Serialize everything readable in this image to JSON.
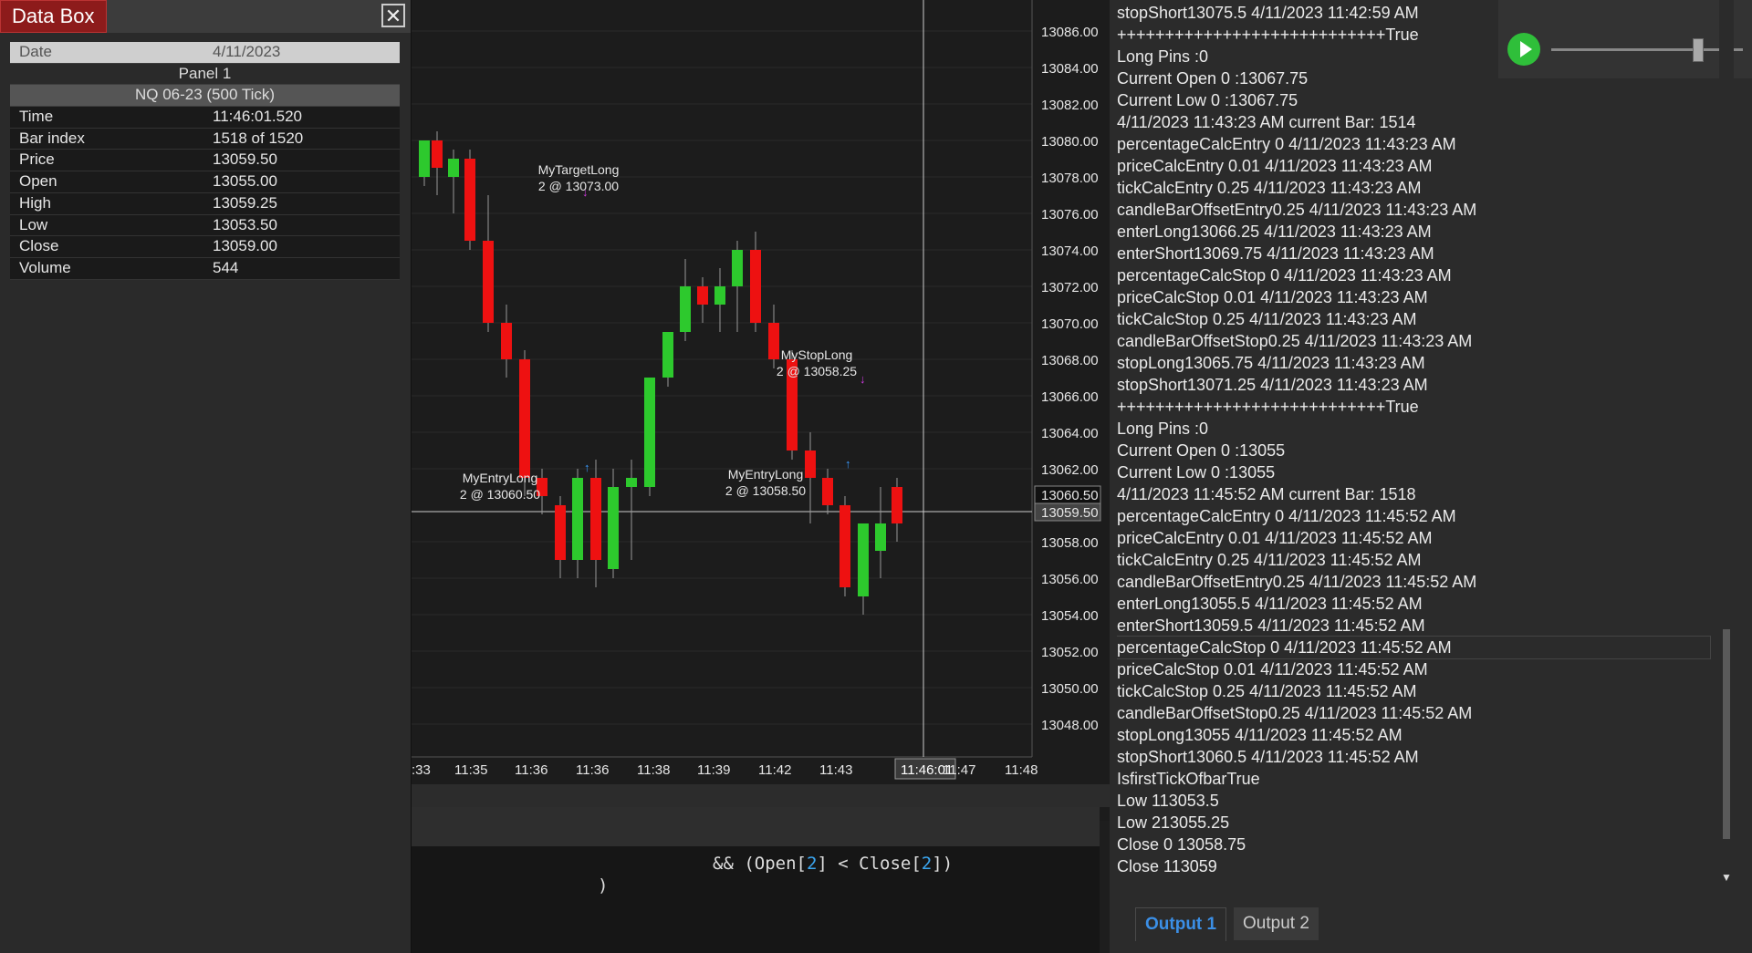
{
  "data_box": {
    "title": "Data Box",
    "close_glyph": "✕",
    "date_label": "Date",
    "date_value": "4/11/2023",
    "panel_label": "Panel 1",
    "instrument": "NQ 06-23 (500 Tick)",
    "rows": [
      {
        "k": "Time",
        "v": "11:46:01.520"
      },
      {
        "k": "Bar index",
        "v": "1518 of 1520"
      },
      {
        "k": "Price",
        "v": "13059.50"
      },
      {
        "k": "Open",
        "v": "13055.00"
      },
      {
        "k": "High",
        "v": "13059.25"
      },
      {
        "k": "Low",
        "v": "13053.50"
      },
      {
        "k": "Close",
        "v": "13059.00"
      },
      {
        "k": "Volume",
        "v": "544"
      }
    ]
  },
  "chart": {
    "price_ticks": [
      "13086.00",
      "13084.00",
      "13082.00",
      "13080.00",
      "13078.00",
      "13076.00",
      "13074.00",
      "13072.00",
      "13070.00",
      "13068.00",
      "13066.00",
      "13064.00",
      "13062.00",
      "13060.50",
      "13059.50",
      "13058.00",
      "13056.00",
      "13054.00",
      "13052.00",
      "13050.00",
      "13048.00"
    ],
    "time_ticks": [
      ":33",
      "11:35",
      "11:36",
      "11:36",
      "11:38",
      "11:39",
      "11:42",
      "11:43",
      "11:46:01",
      "11:47",
      "11:48"
    ],
    "cursor_time": "11:46:01",
    "price_highlight_upper": "13060.50",
    "price_highlight_lower": "13059.50",
    "labels": [
      {
        "name": "MyTargetLong",
        "qty": "2 @ 13073.00"
      },
      {
        "name": "MyStopLong",
        "qty": "2 @ 13058.25"
      },
      {
        "name": "MyEntryLong",
        "qty": "2 @ 13060.50"
      },
      {
        "name": "MyEntryLong",
        "qty": "2 @ 13058.50"
      }
    ],
    "colors": {
      "up": "#2dc92d",
      "down": "#ee1111",
      "bg": "#1c1c1c"
    }
  },
  "code": {
    "line1_prefix": "&& (Open[",
    "line1_n1": "2",
    "line1_mid": "] < Close[",
    "line1_n2": "2",
    "line1_suffix": "])",
    "line2": ")"
  },
  "output": {
    "lines": [
      "stopShort13075.5 4/11/2023 11:42:59 AM",
      "++++++++++++++++++++++++++++True",
      "Long Pins :0",
      "Current Open 0 :13067.75",
      "Current Low 0 :13067.75",
      "4/11/2023 11:43:23 AM current Bar: 1514",
      "percentageCalcEntry 0 4/11/2023 11:43:23 AM",
      "priceCalcEntry 0.01 4/11/2023 11:43:23 AM",
      "tickCalcEntry 0.25 4/11/2023 11:43:23 AM",
      "candleBarOffsetEntry0.25 4/11/2023 11:43:23 AM",
      "enterLong13066.25 4/11/2023 11:43:23 AM",
      "enterShort13069.75 4/11/2023 11:43:23 AM",
      "percentageCalcStop 0 4/11/2023 11:43:23 AM",
      "priceCalcStop 0.01 4/11/2023 11:43:23 AM",
      "tickCalcStop 0.25 4/11/2023 11:43:23 AM",
      "candleBarOffsetStop0.25 4/11/2023 11:43:23 AM",
      "stopLong13065.75 4/11/2023 11:43:23 AM",
      "stopShort13071.25 4/11/2023 11:43:23 AM",
      "++++++++++++++++++++++++++++True",
      "Long Pins :0",
      "Current Open 0 :13055",
      "Current Low 0 :13055",
      "4/11/2023 11:45:52 AM current Bar: 1518",
      "percentageCalcEntry 0 4/11/2023 11:45:52 AM",
      "priceCalcEntry 0.01 4/11/2023 11:45:52 AM",
      "tickCalcEntry 0.25 4/11/2023 11:45:52 AM",
      "candleBarOffsetEntry0.25 4/11/2023 11:45:52 AM",
      "enterLong13055.5 4/11/2023 11:45:52 AM",
      "enterShort13059.5 4/11/2023 11:45:52 AM",
      "percentageCalcStop 0 4/11/2023 11:45:52 AM",
      "priceCalcStop 0.01 4/11/2023 11:45:52 AM",
      "tickCalcStop 0.25 4/11/2023 11:45:52 AM",
      "candleBarOffsetStop0.25 4/11/2023 11:45:52 AM",
      "stopLong13055 4/11/2023 11:45:52 AM",
      "stopShort13060.5 4/11/2023 11:45:52 AM",
      "IsfirstTickOfbarTrue",
      "Low 113053.5",
      "Low 213055.25",
      "Close 0 13058.75",
      "Close 113059"
    ],
    "tabs": [
      "Output 1",
      "Output 2"
    ]
  }
}
